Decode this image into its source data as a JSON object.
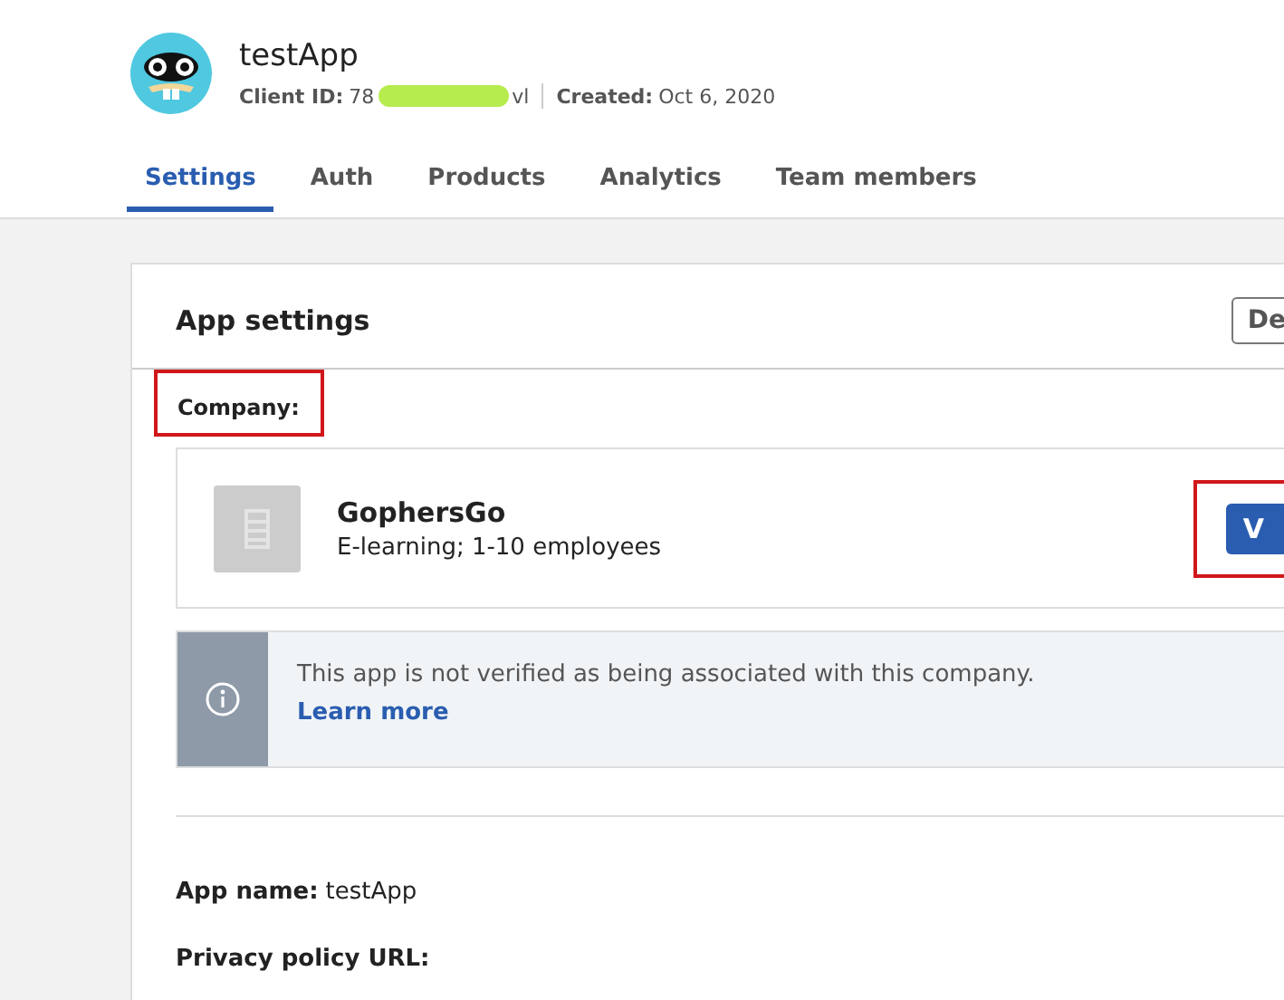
{
  "app": {
    "name": "testApp",
    "client_id_label": "Client ID:",
    "client_id_start": "78",
    "client_id_end": "vl",
    "client_id_redacted": true,
    "created_label": "Created:",
    "created": "Oct 6, 2020"
  },
  "tabs": [
    {
      "label": "Settings",
      "selected": true
    },
    {
      "label": "Auth",
      "selected": false
    },
    {
      "label": "Products",
      "selected": false
    },
    {
      "label": "Analytics",
      "selected": false
    },
    {
      "label": "Team members",
      "selected": false
    }
  ],
  "card": {
    "title": "App settings",
    "header_button": "De",
    "company_label": {
      "text": "Company:",
      "highlighted": true
    },
    "company": {
      "name": "GophersGo",
      "details": "E-learning; 1-10 employees",
      "button": "V",
      "button_highlighted": true
    },
    "notice": {
      "text": "This app is not verified as being associated with this company.",
      "link": "Learn more"
    },
    "fields": [
      {
        "label": "App name:",
        "value": "testApp"
      },
      {
        "label": "Privacy policy URL:"
      }
    ]
  }
}
